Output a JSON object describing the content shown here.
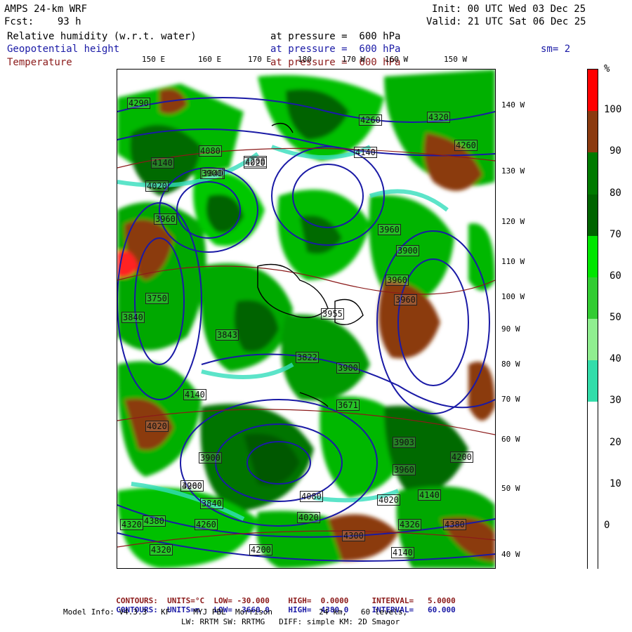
{
  "header": {
    "model": "AMPS 24-km WRF",
    "fcst": "Fcst:    93 h",
    "init": "Init: 00 UTC Wed 03 Dec 25",
    "valid": "Valid: 21 UTC Sat 06 Dec 25",
    "rh_label": "Relative humidity (w.r.t. water)",
    "gh_label": "Geopotential height",
    "temp_label": "Temperature",
    "pressure_line1": "at pressure =  600 hPa",
    "pressure_line2": "at pressure =  600 hPa",
    "pressure_line3": "at pressure =  600 hPa",
    "sm": "sm= 2"
  },
  "lon_labels": [
    "150 E",
    "160 E",
    "170 E",
    "180",
    "170 W",
    "160 W",
    "150 W"
  ],
  "lat_labels": [
    "140 W",
    "130 W",
    "120 W",
    "110 W",
    "100 W",
    "90 W",
    "80 W",
    "70 W",
    "60 W",
    "50 W",
    "40 W"
  ],
  "colorbar": {
    "unit": "%",
    "labels": [
      "100",
      "90",
      "80",
      "70",
      "60",
      "50",
      "40",
      "30",
      "20",
      "10",
      "0"
    ],
    "colors": [
      "#ff0000",
      "#8b3a0f",
      "#007a00",
      "#006400",
      "#00e600",
      "#33cc33",
      "#90ee90",
      "#33ddaa",
      "#ffffff",
      "#ffffff",
      "#ffffff",
      "#ffffff"
    ]
  },
  "height_labels": [
    "4290",
    "4140",
    "4080",
    "4020",
    "3960",
    "3840",
    "3750",
    "3900",
    "4200",
    "4020",
    "4140",
    "4260",
    "4320",
    "3960",
    "3900",
    "3960",
    "3840",
    "3955",
    "3843",
    "3822",
    "3900",
    "3671",
    "3903",
    "3960",
    "4020",
    "4140",
    "4200",
    "4260",
    "4320",
    "4380",
    "4300",
    "4380",
    "4326",
    "3900",
    "3960",
    "4020",
    "4140",
    "4200",
    "3840",
    "4080",
    "4020",
    "4140",
    "4200",
    "4260",
    "4320",
    "3960"
  ],
  "footer": {
    "line1_label": "CONTOURS:",
    "line1_units": "UNITS=°C",
    "line1_low": "LOW= -30.000",
    "line1_high": "HIGH=  0.0000",
    "line1_int": "INTERVAL=   5.0000",
    "line2_label": "CONTOURS:",
    "line2_units": "UNITS=m",
    "line2_low": "LOW=  3660.0",
    "line2_high": "HIGH=  4380.0",
    "line2_int": "INTERVAL=   60.000",
    "model_info": "Model Info: V4.3.3   KF     MYJ PBL  Morrison          24 km,   60 levels,",
    "model_info2": "LW: RRTM SW: RRTMG   DIFF: simple KM: 2D Smagor"
  }
}
